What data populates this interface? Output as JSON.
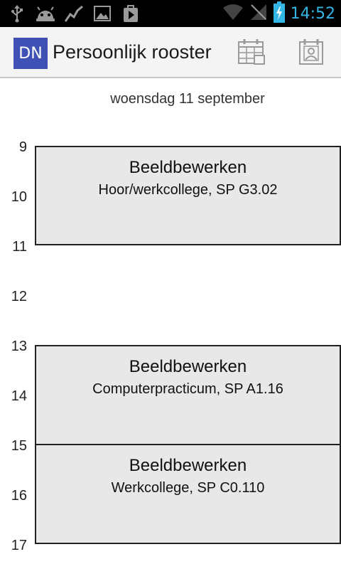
{
  "status_bar": {
    "time": "14:52",
    "icons": [
      "usb-icon",
      "android-debug-icon",
      "activity-graph-icon",
      "gallery-icon",
      "play-store-icon",
      "wifi-icon",
      "no-signal-icon",
      "battery-charging-icon"
    ]
  },
  "action_bar": {
    "logo_text": "DN",
    "title": "Persoonlijk rooster",
    "actions": [
      "calendar-grid-icon",
      "calendar-person-icon"
    ]
  },
  "day": {
    "title": "woensdag 11 september"
  },
  "hours": [
    "9",
    "10",
    "11",
    "12",
    "13",
    "14",
    "15",
    "16",
    "17"
  ],
  "events": [
    {
      "title": "Beeldbewerken",
      "subtitle": "Hoor/werkcollege, SP G3.02"
    },
    {
      "title": "Beeldbewerken",
      "subtitle": "Computerpracticum, SP A1.16"
    },
    {
      "title": "Beeldbewerken",
      "subtitle": "Werkcollege, SP C0.110"
    }
  ]
}
